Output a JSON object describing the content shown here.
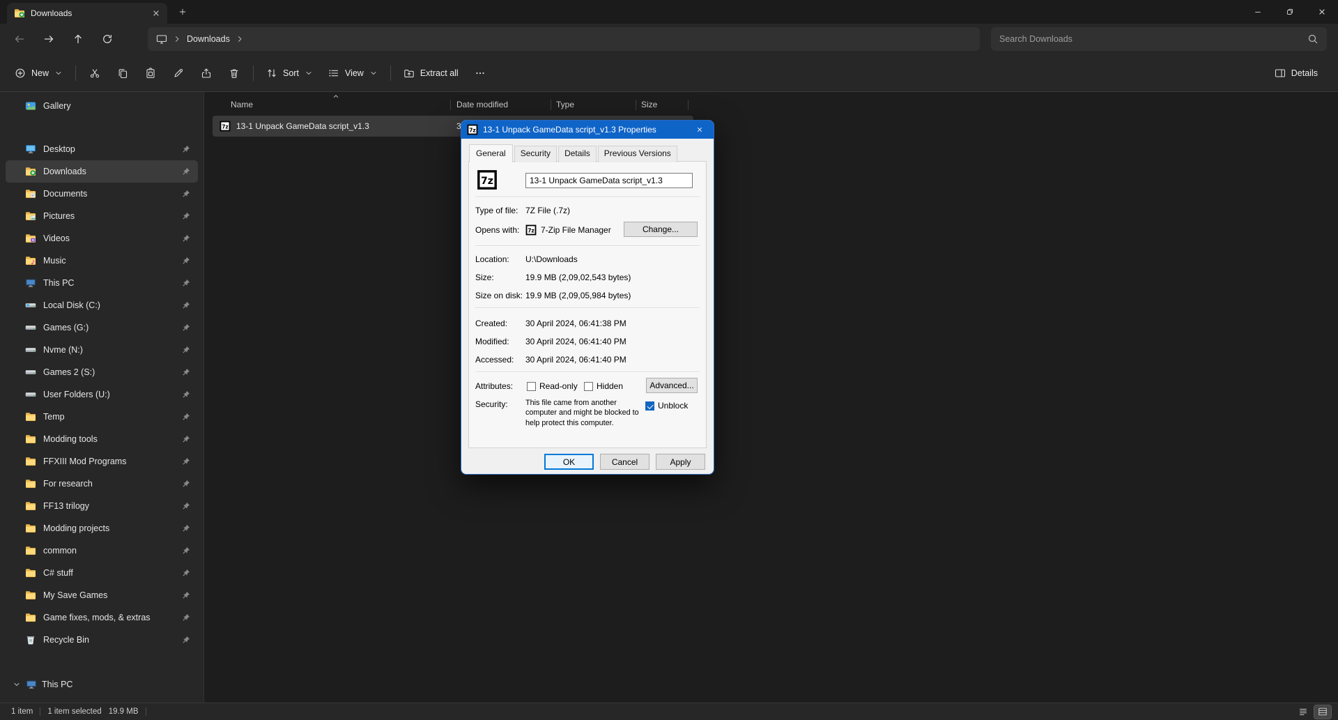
{
  "colors": {
    "accent": "#0078d7",
    "dialog_titlebar": "#0f64c8"
  },
  "window": {
    "tab_title": "Downloads"
  },
  "nav": {
    "breadcrumb": [
      "Downloads"
    ],
    "search_placeholder": "Search Downloads"
  },
  "toolbar": {
    "new_label": "New",
    "sort_label": "Sort",
    "view_label": "View",
    "extract_label": "Extract all",
    "details_label": "Details",
    "icon_names": [
      "new-icon",
      "cut-icon",
      "copy-icon",
      "paste-icon",
      "rename-icon",
      "share-icon",
      "delete-icon",
      "sort-icon",
      "view-icon",
      "extract-icon",
      "more-icon",
      "details-pane-icon"
    ]
  },
  "sidebar": {
    "gallery_label": "Gallery",
    "items": [
      {
        "label": "Desktop",
        "icon": "desktop-icon",
        "pinned": true
      },
      {
        "label": "Downloads",
        "icon": "downloads-icon",
        "pinned": true,
        "selected": true
      },
      {
        "label": "Documents",
        "icon": "documents-icon",
        "pinned": true
      },
      {
        "label": "Pictures",
        "icon": "pictures-icon",
        "pinned": true
      },
      {
        "label": "Videos",
        "icon": "videos-icon",
        "pinned": true
      },
      {
        "label": "Music",
        "icon": "music-icon",
        "pinned": true
      },
      {
        "label": "This PC",
        "icon": "this-pc-icon",
        "pinned": true
      },
      {
        "label": "Local Disk (C:)",
        "icon": "drive-windows-icon",
        "pinned": true
      },
      {
        "label": "Games (G:)",
        "icon": "drive-icon",
        "pinned": true
      },
      {
        "label": "Nvme (N:)",
        "icon": "drive-icon",
        "pinned": true
      },
      {
        "label": "Games 2 (S:)",
        "icon": "drive-icon",
        "pinned": true
      },
      {
        "label": "User Folders (U:)",
        "icon": "drive-icon",
        "pinned": true
      },
      {
        "label": "Temp",
        "icon": "folder-icon",
        "pinned": true
      },
      {
        "label": "Modding tools",
        "icon": "folder-icon",
        "pinned": true
      },
      {
        "label": "FFXIII Mod Programs",
        "icon": "folder-icon",
        "pinned": true
      },
      {
        "label": "For research",
        "icon": "folder-icon",
        "pinned": true
      },
      {
        "label": "FF13 trilogy",
        "icon": "folder-icon",
        "pinned": true
      },
      {
        "label": "Modding projects",
        "icon": "folder-icon",
        "pinned": true
      },
      {
        "label": "common",
        "icon": "folder-icon",
        "pinned": true
      },
      {
        "label": "C# stuff",
        "icon": "folder-icon",
        "pinned": true
      },
      {
        "label": "My Save Games",
        "icon": "folder-icon",
        "pinned": true
      },
      {
        "label": "Game fixes, mods, & extras",
        "icon": "folder-icon",
        "pinned": true
      },
      {
        "label": "Recycle Bin",
        "icon": "recycle-bin-icon",
        "pinned": true
      }
    ],
    "tree_label": "This PC"
  },
  "file_list": {
    "columns": [
      "Name",
      "Date modified",
      "Type",
      "Size"
    ],
    "rows": [
      {
        "icon": "7z-file-icon",
        "name": "13-1 Unpack GameData script_v1.3",
        "date_modified": "30",
        "selected": true
      }
    ]
  },
  "status": {
    "count": "1 item",
    "selection": "1 item selected",
    "selection_size": "19.9 MB"
  },
  "dialog": {
    "title": "13-1 Unpack GameData script_v1.3 Properties",
    "tabs": [
      "General",
      "Security",
      "Details",
      "Previous Versions"
    ],
    "active_tab": "General",
    "file_name": "13-1 Unpack GameData script_v1.3",
    "type_label": "Type of file:",
    "type_value": "7Z File (.7z)",
    "opens_label": "Opens with:",
    "opens_icon": "7z-file-icon",
    "opens_value": "7-Zip File Manager",
    "change_button": "Change...",
    "location_label": "Location:",
    "location_value": "U:\\Downloads",
    "size_label": "Size:",
    "size_value": "19.9 MB (2,09,02,543 bytes)",
    "size_on_disk_label": "Size on disk:",
    "size_on_disk_value": "19.9 MB (2,09,05,984 bytes)",
    "created_label": "Created:",
    "created_value": "30 April 2024, 06:41:38 PM",
    "modified_label": "Modified:",
    "modified_value": "30 April 2024, 06:41:40 PM",
    "accessed_label": "Accessed:",
    "accessed_value": "30 April 2024, 06:41:40 PM",
    "attributes_label": "Attributes:",
    "readonly_label": "Read-only",
    "readonly_checked": false,
    "hidden_label": "Hidden",
    "hidden_checked": false,
    "advanced_button": "Advanced...",
    "security_label": "Security:",
    "security_text": "This file came from another computer and might be blocked to help protect this computer.",
    "unblock_label": "Unblock",
    "unblock_checked": true,
    "ok_button": "OK",
    "cancel_button": "Cancel",
    "apply_button": "Apply"
  }
}
